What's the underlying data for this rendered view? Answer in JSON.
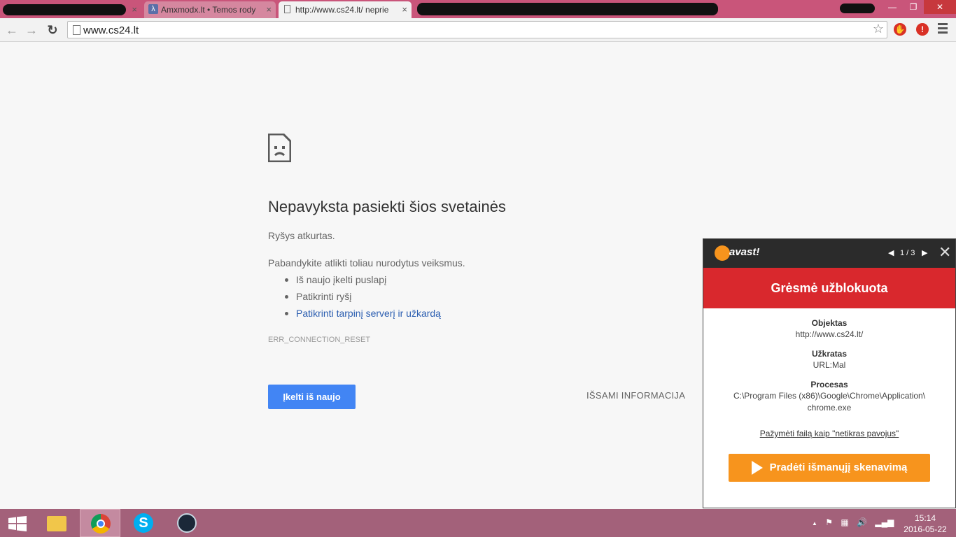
{
  "browser": {
    "tabs": [
      {
        "label": "",
        "redacted": true
      },
      {
        "label": "Amxmodx.lt • Temos rody",
        "icon": "lambda-icon",
        "favicon_text": "λ"
      },
      {
        "label": "http://www.cs24.lt/ neprie",
        "icon": "page-icon",
        "active": true
      }
    ],
    "tab_close_glyph": "×",
    "window_controls": {
      "minimize": "—",
      "restore": "❐",
      "close": "✕"
    },
    "nav": {
      "back": "←",
      "forward": "→",
      "reload": "↻"
    },
    "address": "www.cs24.lt",
    "bookmark_star": "☆",
    "extensions": [
      {
        "name": "adblock-icon",
        "glyph": "✋",
        "color": "#d93025"
      },
      {
        "name": "warning-icon",
        "glyph": "!",
        "color": "#d93025"
      }
    ]
  },
  "error_page": {
    "title": "Nepavyksta pasiekti šios svetainės",
    "subtitle": "Ryšys atkurtas.",
    "try_text": "Pabandykite atlikti toliau nurodytus veiksmus.",
    "suggestions": [
      "Iš naujo įkelti puslapį",
      "Patikrinti ryšį",
      "Patikrinti tarpinį serverį ir užkardą"
    ],
    "error_code": "ERR_CONNECTION_RESET",
    "reload_label": "Įkelti iš naujo",
    "details_label": "IŠSAMI INFORMACIJA"
  },
  "avast": {
    "logo_text": "avast!",
    "prev": "◀",
    "counter": "1 / 3",
    "next": "▶",
    "close": "✕",
    "banner": "Grėsmė užblokuota",
    "object_label": "Objektas",
    "object_value": "http://www.cs24.lt/",
    "threat_label": "Užkratas",
    "threat_value": "URL:Mal",
    "process_label": "Procesas",
    "process_value_line1": "C:\\Program Files (x86)\\Google\\Chrome\\Application\\",
    "process_value_line2": "chrome.exe",
    "mark_link": "Pažymėti failą kaip \"netikras pavojus\"",
    "scan_button": "Pradėti išmanųjį skenavimą",
    "colors": {
      "banner": "#d9282d",
      "button": "#f7941d",
      "header": "#2b2b2b"
    }
  },
  "taskbar": {
    "apps": [
      "start-icon",
      "file-explorer-icon",
      "chrome-icon",
      "skype-icon",
      "steam-icon"
    ],
    "tray": {
      "up": "▲",
      "flag": "⚑",
      "network": "▦",
      "volume": "🔊",
      "signal": "▂▄▆"
    },
    "time": "15:14",
    "date": "2016-05-22"
  }
}
